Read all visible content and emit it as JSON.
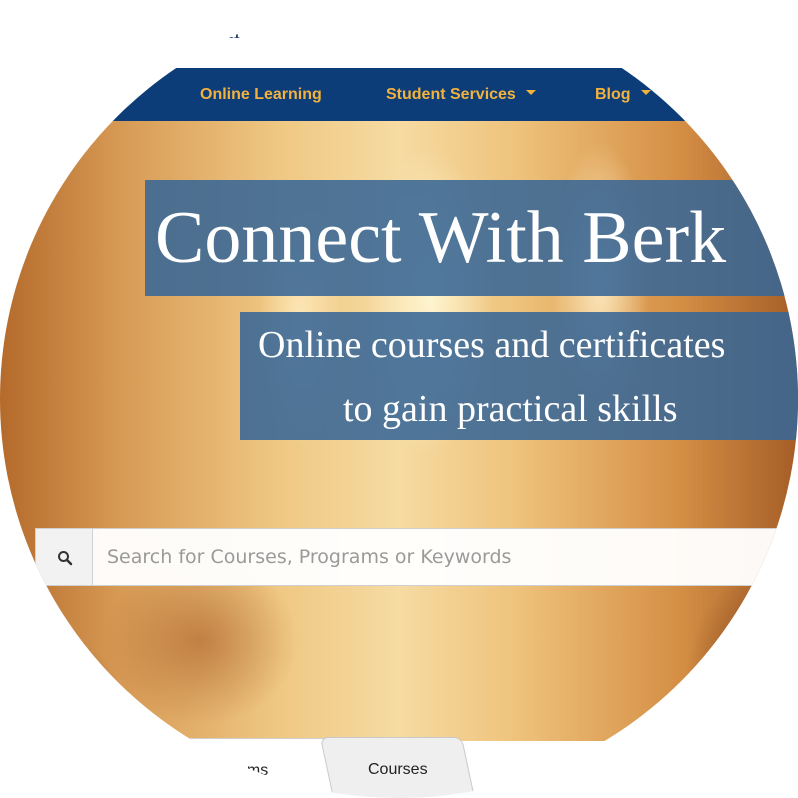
{
  "header": {
    "logo_fragment": "ell"
  },
  "nav": {
    "items": [
      {
        "label": "Online Learning",
        "has_dropdown": false
      },
      {
        "label": "Student Services",
        "has_dropdown": true
      },
      {
        "label": "Blog",
        "has_dropdown": true
      }
    ]
  },
  "hero": {
    "title": "Connect With Berk",
    "subtitle_line1": "Online courses and certificates",
    "subtitle_line2": "to gain practical skills"
  },
  "search": {
    "icon": "search-icon",
    "placeholder": "Search for Courses, Programs or Keywords",
    "value": ""
  },
  "tabs": [
    {
      "label": "ams",
      "active": true
    },
    {
      "label": "Courses",
      "active": false
    }
  ],
  "colors": {
    "nav_bg": "#0c3d78",
    "nav_text": "#f2b23d",
    "hero_box": "#386696"
  }
}
